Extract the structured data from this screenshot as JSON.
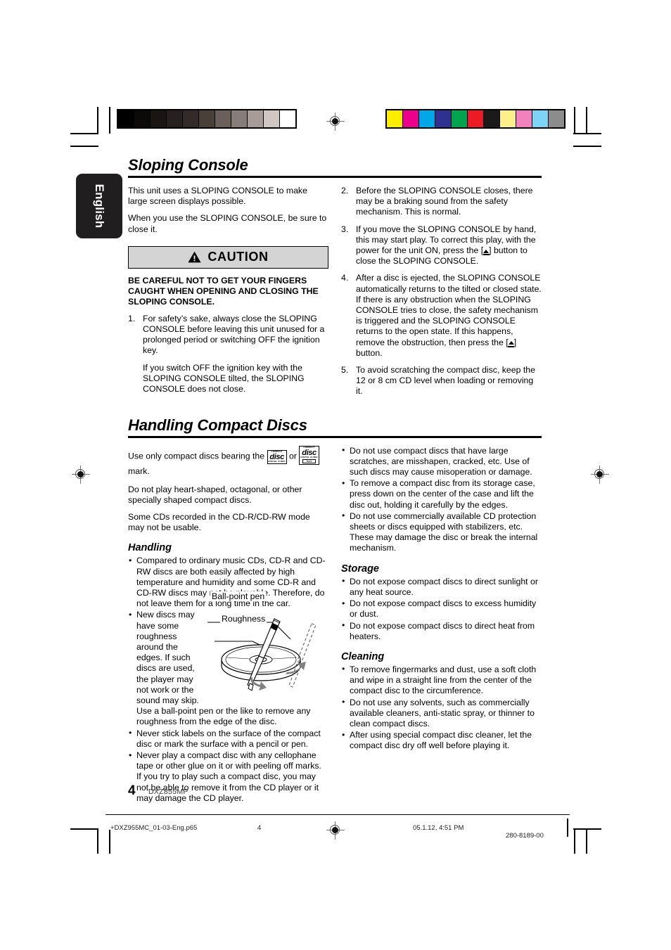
{
  "page": {
    "number": "4",
    "model": "DXZ855MP",
    "language_tab": "English"
  },
  "calibration": {
    "gray_strip": [
      "#000000",
      "#0c0909",
      "#1a1413",
      "#272020",
      "#332b29",
      "#494039",
      "#6a5f59",
      "#877d79",
      "#a79c98",
      "#d0c6c2",
      "#ffffff"
    ],
    "color_strip": [
      "#fdee00",
      "#ec008c",
      "#00a7e7",
      "#2e3192",
      "#00a44f",
      "#ed1c24",
      "#1a1a1a",
      "#fdef8a",
      "#f282be",
      "#7ed4f5",
      "#8c8c8c"
    ]
  },
  "sections": [
    {
      "title": "Sloping Console",
      "left": {
        "intro": [
          "This unit uses a SLOPING CONSOLE to make large screen displays possible.",
          "When you use the SLOPING CONSOLE, be sure to close it."
        ],
        "caution": {
          "label": "CAUTION",
          "icon": "warning-triangle-icon",
          "body": "BE CAREFUL NOT TO GET YOUR FINGERS CAUGHT WHEN OPENING AND CLOSING THE SLOPING CONSOLE."
        },
        "items": [
          {
            "n": "1.",
            "paras": [
              "For safety’s sake, always close the SLOPING CONSOLE before leaving this unit unused for a prolonged period or switching OFF the ignition key.",
              "If you switch OFF the ignition key with the SLOPING CONSOLE tilted, the SLOPING CONSOLE does not close."
            ]
          }
        ]
      },
      "right": {
        "items": [
          {
            "n": "2.",
            "text": "Before the SLOPING CONSOLE closes, there may be a braking sound from the safety mechanism. This is normal."
          },
          {
            "n": "3.",
            "pre": "If you move the SLOPING CONSOLE by hand, this may start play. To correct this play, with the power for the unit ON, press the [",
            "post": "] button to close the SLOPING CONSOLE.",
            "icon": "eject-icon"
          },
          {
            "n": "4.",
            "pre": "After a disc is ejected, the SLOPING CONSOLE automatically returns to the tilted or closed state. If there is any obstruction when the SLOPING CONSOLE tries to close, the safety mechanism is triggered and the SLOPING CONSOLE returns to the open state. If this happens, remove the obstruction, then press the [",
            "post": "] button.",
            "icon": "eject-icon"
          },
          {
            "n": "5.",
            "text": "To avoid scratching the compact disc, keep the 12 or 8 cm CD level when loading or removing it."
          }
        ]
      }
    },
    {
      "title": "Handling Compact Discs",
      "left": {
        "intro_pre": "Use only compact discs bearing the ",
        "intro_or": " or ",
        "intro_post": " mark.",
        "logo_audio": {
          "top": "COMPACT",
          "mid": "disc",
          "bot": "DIGITAL AUDIO"
        },
        "logo_text": {
          "top": "COMPACT",
          "mid": "disc",
          "bot": "DIGITAL AUDIO",
          "bot2": "TEXT"
        },
        "paras": [
          "Do not play heart-shaped, octagonal, or other specially shaped compact discs.",
          "Some CDs recorded in the CD-R/CD-RW mode may not be usable."
        ],
        "handling": {
          "heading": "Handling",
          "bullets": [
            "Compared to ordinary music CDs, CD-R and CD-RW discs are both easily affected by high temperature and humidity and some CD-R and CD-RW discs may not be playable. Therefore, do not leave them for a long time in the car.",
            "New discs may have some roughness around the edges. If such discs are used, the player may not work or the sound may skip. Use a ball-point pen or the like to remove any roughness from the edge of the disc.",
            "Never stick labels on the surface of the compact disc or mark the surface with a pencil or pen.",
            "Never play a compact disc with any cellophane tape or other glue on it or with peeling off marks. If you try to play such a compact disc, you may not be able to remove it from the CD player or it may damage the CD player."
          ]
        },
        "illustration": {
          "name": "disc-deburring-illustration",
          "callouts": [
            "Ball-point pen",
            "Roughness"
          ]
        }
      },
      "right": {
        "bullets": [
          "Do not use compact discs that have large scratches, are misshapen, cracked, etc. Use of such discs may cause misoperation or damage.",
          "To remove a compact disc from its storage case, press down on the center of the case and lift the disc out, holding it carefully by the edges.",
          "Do not use commercially available CD protection sheets or discs equipped with stabilizers, etc. These may damage the disc or break the internal mechanism."
        ],
        "storage": {
          "heading": "Storage",
          "bullets": [
            "Do not expose compact discs to direct sunlight or any heat source.",
            "Do not expose compact discs to excess humidity or dust.",
            "Do not expose compact discs to direct heat from heaters."
          ]
        },
        "cleaning": {
          "heading": "Cleaning",
          "bullets": [
            "To remove fingermarks and dust, use a soft cloth and wipe in a straight line from the center of the compact disc to the circumference.",
            "Do not use any solvents, such as commercially available cleaners, anti-static spray, or thinner to clean compact discs.",
            "After using special compact disc cleaner, let the compact disc dry off well before playing it."
          ]
        }
      }
    }
  ],
  "footer": {
    "filename": "+DXZ955MC_01-03-Eng.p65",
    "page": "4",
    "timestamp": "05.1.12, 4:51 PM",
    "doc_code": "280-8189-00"
  }
}
